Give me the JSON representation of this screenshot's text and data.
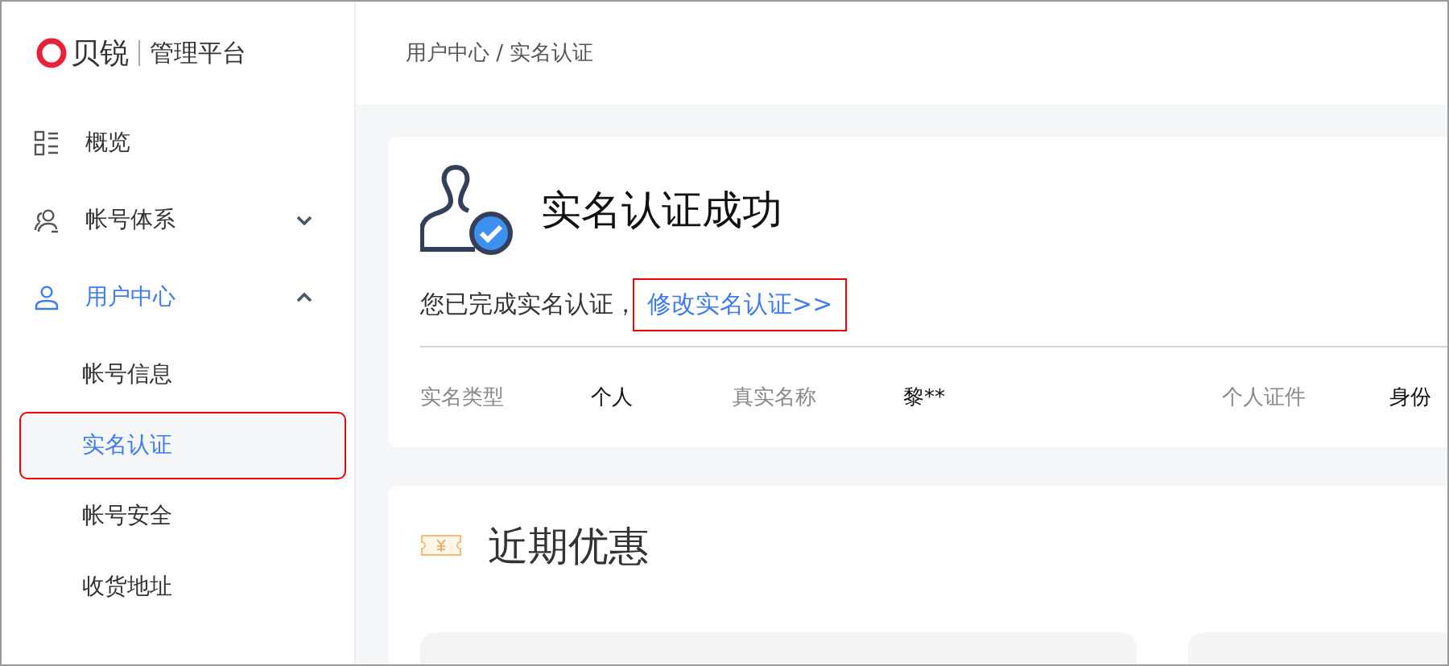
{
  "logo": {
    "brand": "贝锐",
    "subtitle": "管理平台"
  },
  "sidebar": {
    "items": [
      {
        "label": "概览",
        "kind": "link",
        "selected": false
      },
      {
        "label": "帐号体系",
        "kind": "group",
        "selected": false,
        "expanded": false
      },
      {
        "label": "用户中心",
        "kind": "group",
        "selected": true,
        "expanded": true,
        "children": [
          {
            "label": "帐号信息",
            "selected": false,
            "highlighted": false
          },
          {
            "label": "实名认证",
            "selected": true,
            "highlighted": true
          },
          {
            "label": "帐号安全",
            "selected": false,
            "highlighted": false
          },
          {
            "label": "收货地址",
            "selected": false,
            "highlighted": false
          }
        ]
      }
    ]
  },
  "breadcrumb": "用户中心 / 实名认证",
  "verification": {
    "title": "实名认证成功",
    "message": "您已完成实名认证，",
    "link": {
      "label": "修改实名认证>>",
      "highlighted": true
    },
    "fields": [
      {
        "label": "实名类型",
        "value": "个人"
      },
      {
        "label": "真实名称",
        "value": "黎**"
      },
      {
        "label": "个人证件",
        "value": "身份"
      }
    ]
  },
  "offers": {
    "title": "近期优惠"
  }
}
